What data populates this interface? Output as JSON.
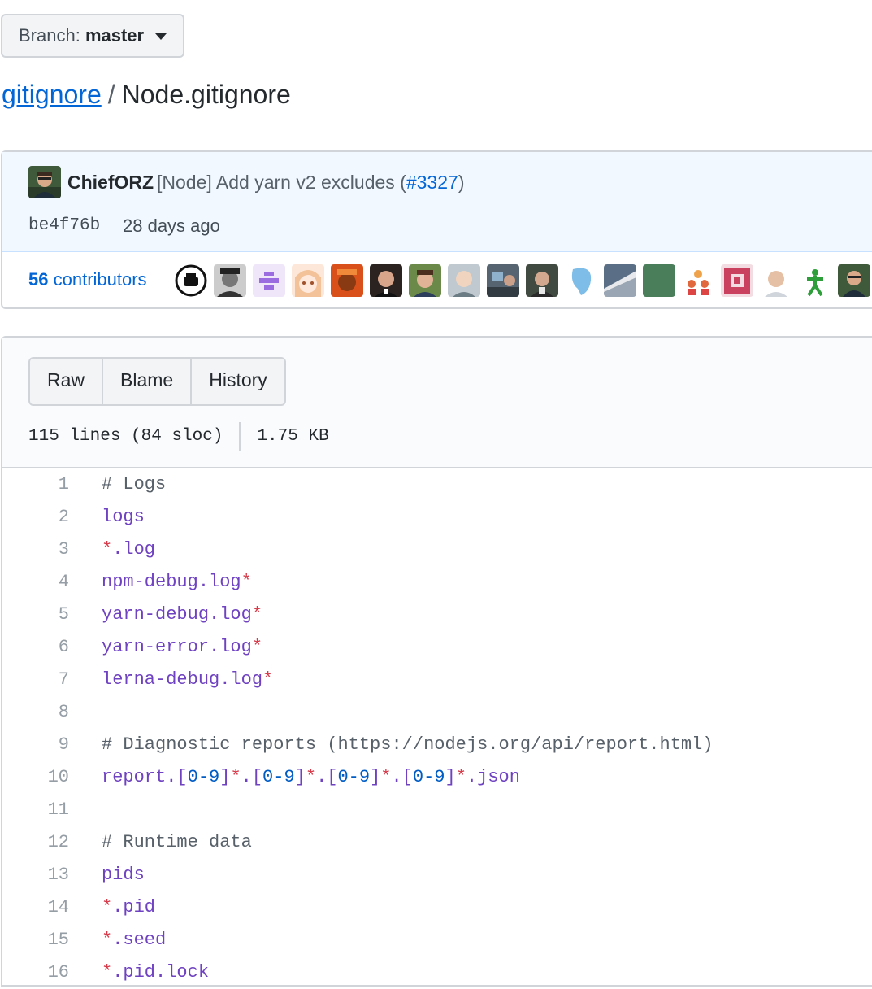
{
  "branch": {
    "label": "Branch:",
    "value": "master"
  },
  "breadcrumb": {
    "repo": "gitignore",
    "separator": "/",
    "file": "Node.gitignore"
  },
  "commit": {
    "author": "ChiefORZ",
    "message_prefix": "[Node] Add yarn v2 excludes (",
    "pr": "#3327",
    "message_suffix": ")",
    "sha": "be4f76b",
    "time": "28 days ago"
  },
  "contributors": {
    "count": "56",
    "label": "contributors"
  },
  "file_actions": {
    "raw": "Raw",
    "blame": "Blame",
    "history": "History"
  },
  "file_info": {
    "lines": "115 lines (84 sloc)",
    "size": "1.75 KB"
  },
  "code": [
    {
      "n": "1",
      "t": "# Logs"
    },
    {
      "n": "2",
      "t": "logs"
    },
    {
      "n": "3",
      "t": "*.log"
    },
    {
      "n": "4",
      "t": "npm-debug.log*"
    },
    {
      "n": "5",
      "t": "yarn-debug.log*"
    },
    {
      "n": "6",
      "t": "yarn-error.log*"
    },
    {
      "n": "7",
      "t": "lerna-debug.log*"
    },
    {
      "n": "8",
      "t": ""
    },
    {
      "n": "9",
      "t": "# Diagnostic reports (https://nodejs.org/api/report.html)"
    },
    {
      "n": "10",
      "t": "report.[0-9]*.[0-9]*.[0-9]*.[0-9]*.json"
    },
    {
      "n": "11",
      "t": ""
    },
    {
      "n": "12",
      "t": "# Runtime data"
    },
    {
      "n": "13",
      "t": "pids"
    },
    {
      "n": "14",
      "t": "*.pid"
    },
    {
      "n": "15",
      "t": "*.seed"
    },
    {
      "n": "16",
      "t": "*.pid.lock"
    }
  ],
  "colors": {
    "link": "#0366d6",
    "comment": "#586069",
    "pattern": "#6f42c1",
    "wildcard": "#d73a49",
    "range": "#005cc5"
  }
}
